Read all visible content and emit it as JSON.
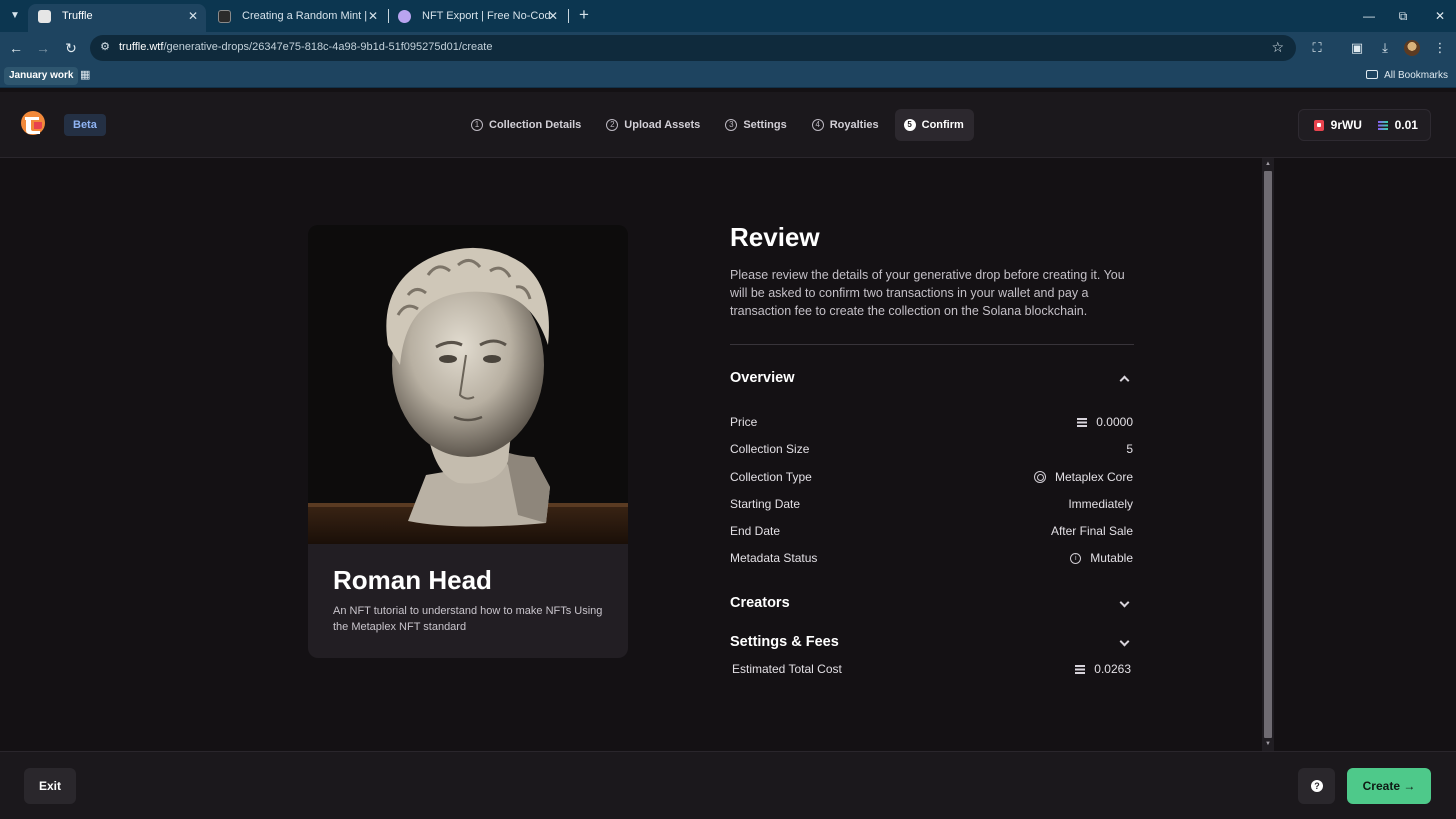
{
  "browser": {
    "tabs": [
      {
        "title": "Truffle",
        "active": true
      },
      {
        "title": "Creating a Random Mint | Truffl",
        "active": false
      },
      {
        "title": "NFT Export | Free No-Code NFT",
        "active": false
      }
    ],
    "url_host": "truffle.wtf",
    "url_path": "/generative-drops/26347e75-818c-4a98-9b1d-51f095275d01/create",
    "bookmark": "January work",
    "all_bookmarks": "All Bookmarks"
  },
  "header": {
    "beta_label": "Beta",
    "steps": [
      {
        "num": "1",
        "label": "Collection Details"
      },
      {
        "num": "2",
        "label": "Upload Assets"
      },
      {
        "num": "3",
        "label": "Settings"
      },
      {
        "num": "4",
        "label": "Royalties"
      },
      {
        "num": "5",
        "label": "Confirm"
      }
    ],
    "wallet_address": "9rWU",
    "wallet_balance": "0.01"
  },
  "collection": {
    "name": "Roman Head",
    "description": "An NFT tutorial to understand how to make NFTs Using the Metaplex NFT standard"
  },
  "review": {
    "title": "Review",
    "text": "Please review the details of your generative drop before creating it. You will be asked to confirm two transactions in your wallet and pay a transaction fee to create the collection on the Solana blockchain.",
    "overview_label": "Overview",
    "rows": [
      {
        "label": "Price",
        "value": "0.0000"
      },
      {
        "label": "Collection Size",
        "value": "5"
      },
      {
        "label": "Collection Type",
        "value": "Metaplex Core"
      },
      {
        "label": "Starting Date",
        "value": "Immediately"
      },
      {
        "label": "End Date",
        "value": "After Final Sale"
      },
      {
        "label": "Metadata Status",
        "value": "Mutable"
      }
    ],
    "creators_label": "Creators",
    "settings_fees_label": "Settings & Fees",
    "estimated_cost_label": "Estimated Total Cost",
    "estimated_cost_value": "0.0263"
  },
  "footer": {
    "exit_label": "Exit",
    "create_label": "Create"
  },
  "colors": {
    "accent_green": "#4ec98a",
    "beta_text": "#8fb4f4",
    "background": "#141114"
  }
}
